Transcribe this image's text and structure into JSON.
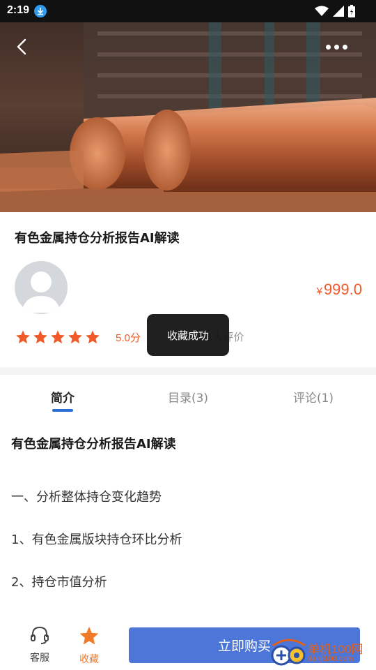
{
  "status_bar": {
    "time": "2:19"
  },
  "product": {
    "title": "有色金属持仓分析报告AI解读",
    "price_symbol": "¥",
    "price": "999.0",
    "rating_score": "5.0分",
    "rating_value": 5,
    "rating_extra": "1人评价"
  },
  "toast": {
    "text": "收藏成功"
  },
  "tabs": [
    {
      "label": "简介"
    },
    {
      "label": "目录(3)"
    },
    {
      "label": "评论(1)"
    }
  ],
  "content": {
    "title": "有色金属持仓分析报告AI解读",
    "lines": [
      "一、分析整体持仓变化趋势",
      "1、有色金属版块持仓环比分析",
      "2、持仓市值分析"
    ]
  },
  "bottom_bar": {
    "customer_service": "客服",
    "favorite": "收藏",
    "buy": "立即购买"
  },
  "watermark": {
    "name": "单机100网",
    "url": "danji100.com"
  },
  "colors": {
    "accent": "#f05a28",
    "tab_indicator": "#2a6fd6",
    "buy_button": "#4d76d9"
  }
}
